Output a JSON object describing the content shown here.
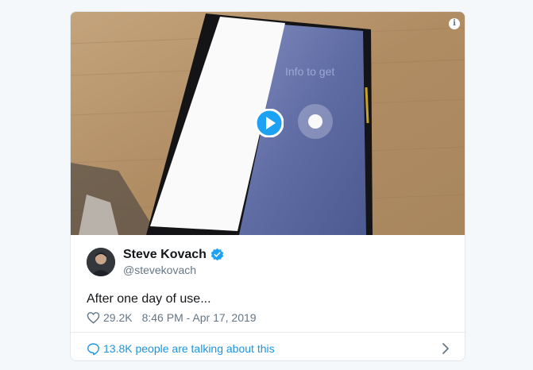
{
  "tweet": {
    "author": {
      "display_name": "Steve Kovach",
      "handle": "@stevekovach",
      "verified": true
    },
    "text": "After one day of use...",
    "likes": "29.2K",
    "timestamp": "8:46 PM - Apr 17, 2019",
    "conversation_label": "13.8K people are talking about this",
    "media": {
      "type": "video",
      "overlay_text": "Info to get"
    }
  },
  "icons": {
    "info": "info-icon",
    "play": "play-icon",
    "verified": "verified-badge-icon",
    "heart": "heart-icon",
    "comment": "speech-bubble-icon",
    "chevron": "chevron-right-icon"
  },
  "colors": {
    "accent": "#1da1f2",
    "link": "#1b95e0",
    "muted": "#657786",
    "text": "#14171a"
  }
}
